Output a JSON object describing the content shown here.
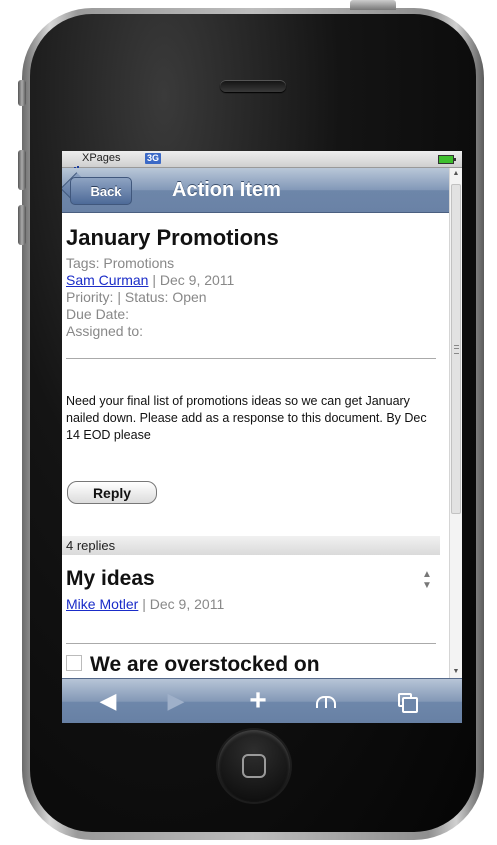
{
  "status_bar": {
    "carrier": "XPages",
    "network": "3G"
  },
  "nav": {
    "back_label": "Back",
    "title": "Action Item"
  },
  "document": {
    "title": "January Promotions",
    "tags_line": "Tags: Promotions",
    "author": "Sam Curman",
    "date": " | Dec 9, 2011",
    "priority_line": "Priority:  | Status: Open",
    "due_line": "Due Date:",
    "assigned_line": "Assigned to:",
    "body": "Need your final list of promotions ideas so we can get January nailed down. Please add as a response to this document. By Dec 14 EOD please",
    "reply_label": "Reply"
  },
  "replies": {
    "count_label": "4 replies",
    "items": [
      {
        "title": "My ideas",
        "author": "Mike Motler",
        "date": " | Dec 9, 2011"
      },
      {
        "title": "We are overstocked on"
      }
    ]
  },
  "icons": {
    "toolbar": [
      "back-arrow-icon",
      "forward-arrow-icon",
      "add-bookmark-icon",
      "bookmarks-icon",
      "pages-icon"
    ],
    "status": [
      "signal-icon",
      "battery-icon"
    ]
  }
}
